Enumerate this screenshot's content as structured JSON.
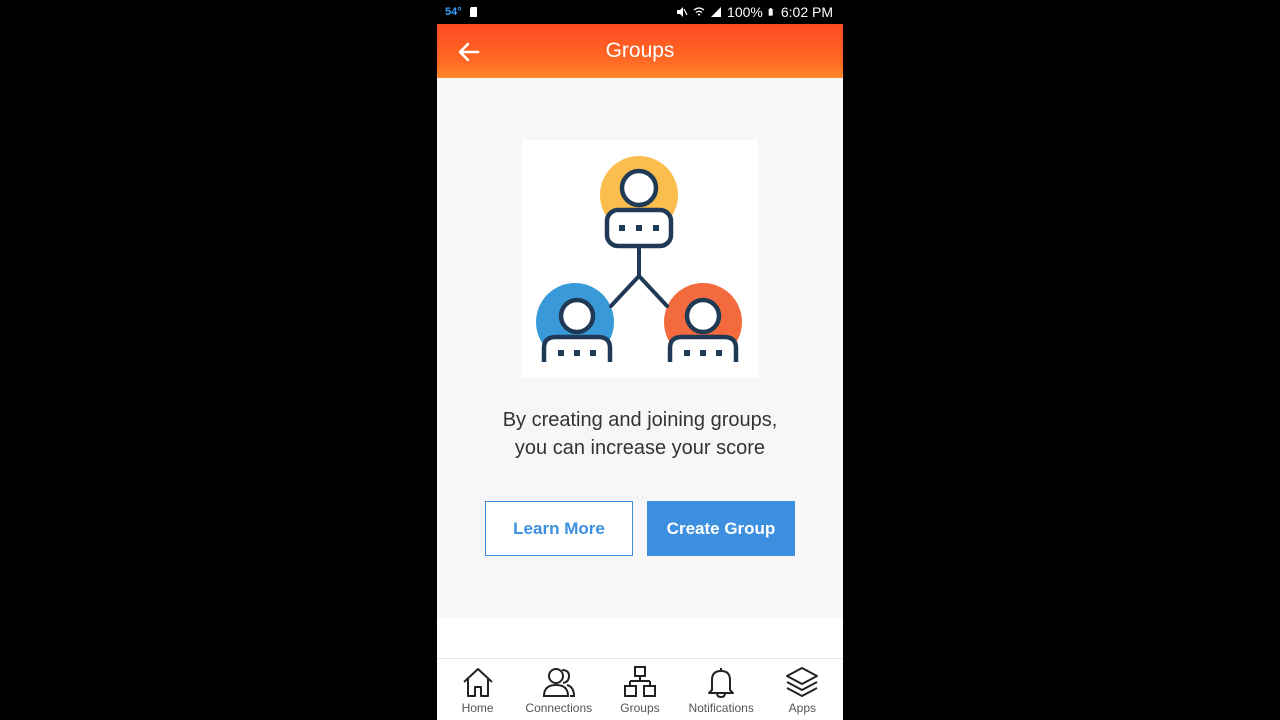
{
  "status_bar": {
    "temperature": "54°",
    "battery": "100%",
    "time": "6:02 PM"
  },
  "app_bar": {
    "title": "Groups",
    "back_icon": "arrow-left-icon"
  },
  "main": {
    "illustration": "group-network-illustration",
    "message_line1": "By creating and joining groups,",
    "message_line2": "you can increase your score",
    "learn_more_label": "Learn More",
    "create_group_label": "Create Group"
  },
  "bottom_nav": {
    "items": [
      {
        "label": "Home",
        "icon": "home-icon"
      },
      {
        "label": "Connections",
        "icon": "connections-icon"
      },
      {
        "label": "Groups",
        "icon": "groups-icon"
      },
      {
        "label": "Notifications",
        "icon": "bell-icon"
      },
      {
        "label": "Apps",
        "icon": "layers-icon"
      }
    ]
  },
  "colors": {
    "appbar": "#ff5a24",
    "accent": "#3d8fe0",
    "avatar_top": "#fbbd4d",
    "avatar_left": "#3a9ad9",
    "avatar_right": "#f26a3d",
    "line": "#1f3a55"
  }
}
